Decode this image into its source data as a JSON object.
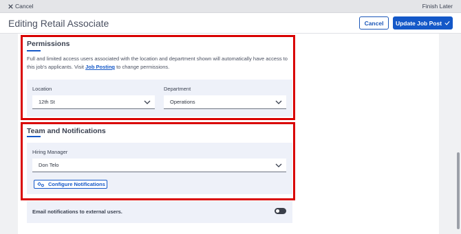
{
  "topbar": {
    "cancel_label": "Cancel",
    "finish_later_label": "Finish Later"
  },
  "header": {
    "title": "Editing Retail Associate",
    "cancel_label": "Cancel",
    "update_label": "Update Job Post"
  },
  "permissions": {
    "title": "Permissions",
    "description_prefix": "Full and limited access users associated with the location and department shown will automatically have access to this job's applicants. Visit ",
    "link_text": "Job Posting",
    "description_suffix": " to change permissions.",
    "location_label": "Location",
    "location_value": "12th St",
    "department_label": "Department",
    "department_value": "Operations"
  },
  "team": {
    "title": "Team and Notifications",
    "hiring_manager_label": "Hiring Manager",
    "hiring_manager_value": "Don Telo",
    "configure_label": "Configure Notifications"
  },
  "email": {
    "label": "Email notifications to external users.",
    "toggle_on": false
  },
  "colors": {
    "accent": "#1458c8",
    "highlight": "#d90000",
    "panel": "#eef1f9"
  },
  "icons": {
    "close": "close-icon",
    "check": "check-icon",
    "chevron": "chevron-down-icon",
    "settings": "settings-icon"
  }
}
